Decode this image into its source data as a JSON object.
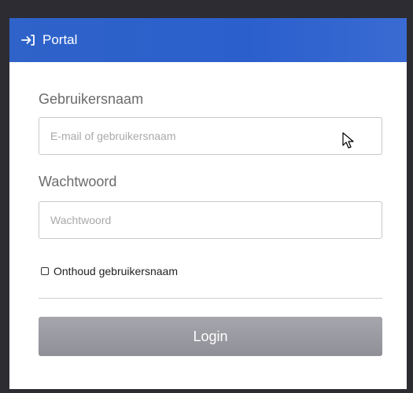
{
  "header": {
    "title": "Portal",
    "icon": "sign-in-icon"
  },
  "form": {
    "username_label": "Gebruikersnaam",
    "username_placeholder": "E-mail of gebruikersnaam",
    "username_value": "",
    "password_label": "Wachtwoord",
    "password_placeholder": "Wachtwoord",
    "password_value": "",
    "remember_label": "Onthoud gebruikersnaam",
    "remember_checked": false,
    "login_label": "Login"
  },
  "colors": {
    "header": "#2f63c9",
    "button": "#9c9ca4",
    "background": "#2e2c33"
  }
}
